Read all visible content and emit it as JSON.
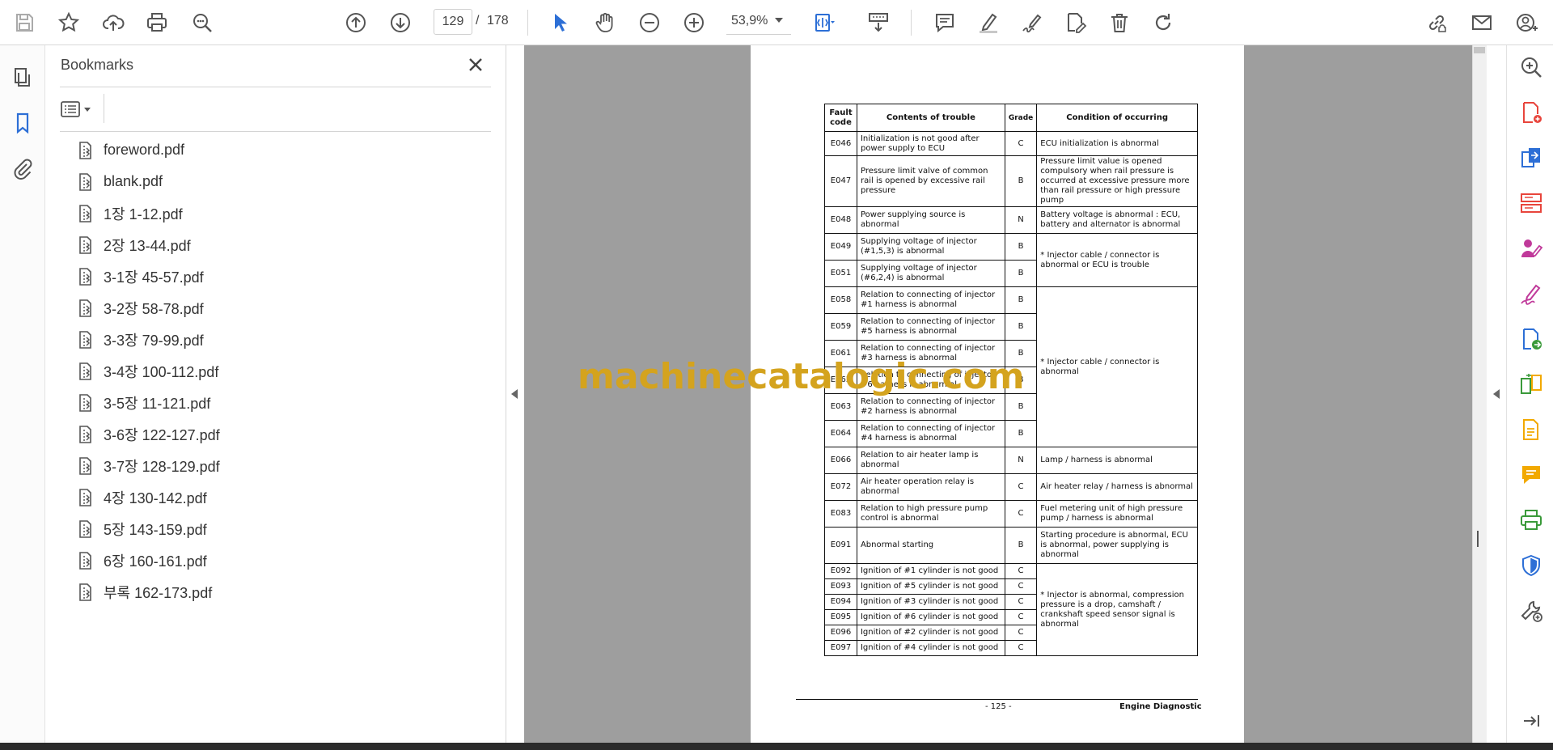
{
  "toolbar": {
    "page_current": "129",
    "page_separator": "/",
    "page_total": "178",
    "zoom": "53,9%"
  },
  "bookmarks": {
    "title": "Bookmarks",
    "items": [
      {
        "label": "foreword.pdf"
      },
      {
        "label": "blank.pdf"
      },
      {
        "label": "1장 1-12.pdf"
      },
      {
        "label": "2장 13-44.pdf"
      },
      {
        "label": "3-1장 45-57.pdf"
      },
      {
        "label": "3-2장 58-78.pdf"
      },
      {
        "label": "3-3장 79-99.pdf"
      },
      {
        "label": "3-4장 100-112.pdf"
      },
      {
        "label": "3-5장 11-121.pdf"
      },
      {
        "label": "3-6장 122-127.pdf"
      },
      {
        "label": "3-7장 128-129.pdf"
      },
      {
        "label": "4장 130-142.pdf"
      },
      {
        "label": "5장 143-159.pdf"
      },
      {
        "label": "6장 160-161.pdf"
      },
      {
        "label": "부록 162-173.pdf"
      }
    ]
  },
  "document": {
    "headers": {
      "code": "Fault code",
      "contents": "Contents of trouble",
      "grade": "Grade",
      "condition": "Condition of occurring"
    },
    "rows": [
      {
        "code": "E046",
        "contents": "Initialization is not good after power supply to ECU",
        "grade": "C"
      },
      {
        "code": "E047",
        "contents": "Pressure limit valve of common rail is opened by excessive rail pressure",
        "grade": "B"
      },
      {
        "code": "E048",
        "contents": "Power supplying source is abnormal",
        "grade": "N"
      },
      {
        "code": "E049",
        "contents": "Supplying voltage of injector (#1,5,3) is abnormal",
        "grade": "B"
      },
      {
        "code": "E051",
        "contents": "Supplying voltage of injector (#6,2,4) is abnormal",
        "grade": "B"
      },
      {
        "code": "E058",
        "contents": "Relation to connecting of injector #1 harness is abnormal",
        "grade": "B"
      },
      {
        "code": "E059",
        "contents": "Relation to connecting of injector #5 harness is abnormal",
        "grade": "B"
      },
      {
        "code": "E061",
        "contents": "Relation to connecting of injector #3 harness is abnormal",
        "grade": "B"
      },
      {
        "code": "E062",
        "contents": "Relation to connecting of injector #6 harness is abnormal",
        "grade": "B"
      },
      {
        "code": "E063",
        "contents": "Relation to connecting of injector #2 harness is abnormal",
        "grade": "B"
      },
      {
        "code": "E064",
        "contents": "Relation to connecting of injector #4 harness is abnormal",
        "grade": "B"
      },
      {
        "code": "E066",
        "contents": "Relation to air heater lamp is abnormal",
        "grade": "N"
      },
      {
        "code": "E072",
        "contents": "Air heater operation relay is abnormal",
        "grade": "C"
      },
      {
        "code": "E083",
        "contents": "Relation to high pressure pump control is abnormal",
        "grade": "C"
      },
      {
        "code": "E091",
        "contents": "Abnormal starting",
        "grade": "B"
      },
      {
        "code": "E092",
        "contents": "Ignition of #1 cylinder is not good",
        "grade": "C"
      },
      {
        "code": "E093",
        "contents": "Ignition of #5 cylinder is not good",
        "grade": "C"
      },
      {
        "code": "E094",
        "contents": "Ignition of #3 cylinder is not good",
        "grade": "C"
      },
      {
        "code": "E095",
        "contents": "Ignition of #6 cylinder is not good",
        "grade": "C"
      },
      {
        "code": "E096",
        "contents": "Ignition of #2 cylinder is not good",
        "grade": "C"
      },
      {
        "code": "E097",
        "contents": "Ignition of #4 cylinder is not good",
        "grade": "C"
      }
    ],
    "conditions": {
      "E046": "ECU initialization is abnormal",
      "E047": "Pressure limit value is opened compulsory when rail pressure is occurred at excessive pressure more than rail pressure or high pressure pump",
      "E048": "Battery voltage is abnormal : ECU, battery and alternator is abnormal",
      "injector_supply": "* Injector cable / connector is abnormal or ECU is trouble",
      "injector_harness": "* Injector cable / connector is abnormal",
      "E066": "Lamp / harness is abnormal",
      "E072": "Air heater relay / harness is abnormal",
      "E083": "Fuel metering unit of high pressure pump / harness  is abnormal",
      "E091": "Starting procedure is abnormal, ECU is abnormal, power supplying is abnormal",
      "ignition": "* Injector is abnormal, compression pressure is a drop, camshaft / crankshaft speed sensor signal is abnormal"
    },
    "footer": {
      "page_number": "- 125 -",
      "section": "Engine Diagnostic"
    },
    "watermark": "machinecatalogic.com"
  },
  "colors": {
    "accent_blue": "#2d6fd6",
    "watermark_gold": "#d4a31e",
    "viewport_gray": "#9e9e9e",
    "tool_red": "#e8453c",
    "tool_magenta": "#c0399a",
    "tool_green": "#3a9a3a",
    "tool_yellow": "#f2a900"
  },
  "icons": {
    "toolbar": [
      "save-icon",
      "star-icon",
      "upload-icon",
      "print-icon",
      "zoom-search-icon",
      "prev-page-icon",
      "next-page-icon",
      "select-cursor-icon",
      "hand-icon",
      "zoom-out-icon",
      "zoom-in-icon",
      "fit-page-icon",
      "scroll-mode-icon",
      "comment-icon",
      "highlight-icon",
      "sign-icon",
      "edit-pdf-icon",
      "delete-icon",
      "rotate-icon",
      "share-link-icon",
      "email-icon",
      "account-icon"
    ],
    "right_tools": [
      "zoom-tool-icon",
      "create-pdf-icon",
      "export-pdf-icon",
      "organize-pages-icon",
      "request-signature-icon",
      "fill-sign-icon",
      "send-review-icon",
      "compare-icon",
      "scan-ocr-icon",
      "comment-tool-icon",
      "print-production-icon",
      "protect-icon",
      "more-tools-icon",
      "collapse-rail-icon"
    ]
  }
}
